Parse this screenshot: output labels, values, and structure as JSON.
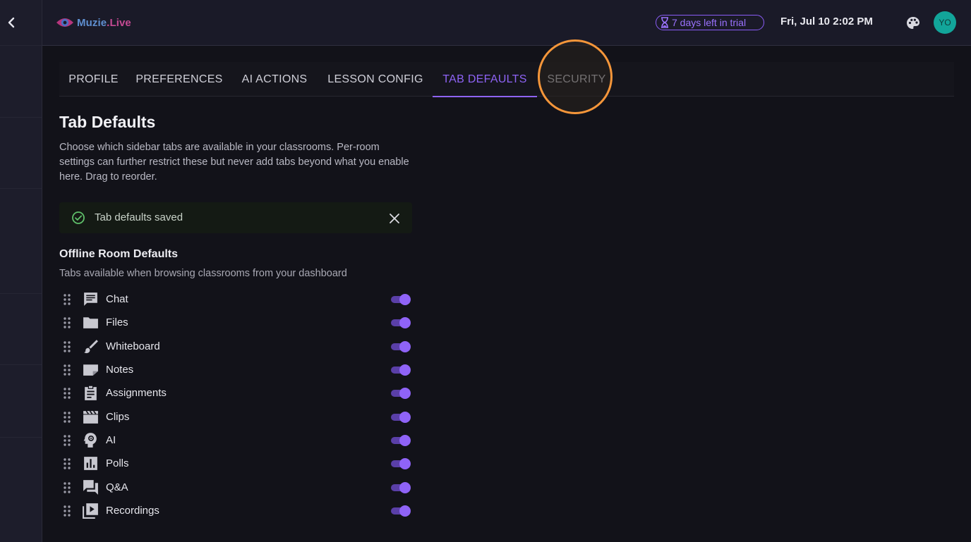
{
  "app": {
    "brand_prefix": "Muzie",
    "brand_suffix": ".Live"
  },
  "header": {
    "trial_text": "7 days left in trial",
    "datetime": "Fri, Jul 10 2:02 PM",
    "avatar_initials": "YO"
  },
  "tabs": [
    {
      "label": "PROFILE",
      "active": false
    },
    {
      "label": "PREFERENCES",
      "active": false
    },
    {
      "label": "AI ACTIONS",
      "active": false
    },
    {
      "label": "LESSON CONFIG",
      "active": false
    },
    {
      "label": "TAB DEFAULTS",
      "active": true
    },
    {
      "label": "SECURITY",
      "active": false
    }
  ],
  "page": {
    "title": "Tab Defaults",
    "description": "Choose which sidebar tabs are available in your classrooms. Per-room settings can further restrict these but never add tabs beyond what you enable here. Drag to reorder."
  },
  "alert": {
    "message": "Tab defaults saved",
    "status_color": "#5fbf6a"
  },
  "offline_section": {
    "title": "Offline Room Defaults",
    "subtitle": "Tabs available when browsing classrooms from your dashboard",
    "items": [
      {
        "label": "Chat",
        "icon": "chat-icon",
        "enabled": true
      },
      {
        "label": "Files",
        "icon": "folder-icon",
        "enabled": true
      },
      {
        "label": "Whiteboard",
        "icon": "brush-icon",
        "enabled": true
      },
      {
        "label": "Notes",
        "icon": "note-icon",
        "enabled": true
      },
      {
        "label": "Assignments",
        "icon": "clipboard-icon",
        "enabled": true
      },
      {
        "label": "Clips",
        "icon": "clapperboard-icon",
        "enabled": true
      },
      {
        "label": "AI",
        "icon": "ai-head-icon",
        "enabled": true
      },
      {
        "label": "Polls",
        "icon": "poll-icon",
        "enabled": true
      },
      {
        "label": "Q&A",
        "icon": "forum-icon",
        "enabled": true
      },
      {
        "label": "Recordings",
        "icon": "video-library-icon",
        "enabled": true
      }
    ]
  },
  "colors": {
    "accent": "#8e63f5",
    "highlight_ring": "#f5963a",
    "avatar_bg": "#12a59a"
  }
}
